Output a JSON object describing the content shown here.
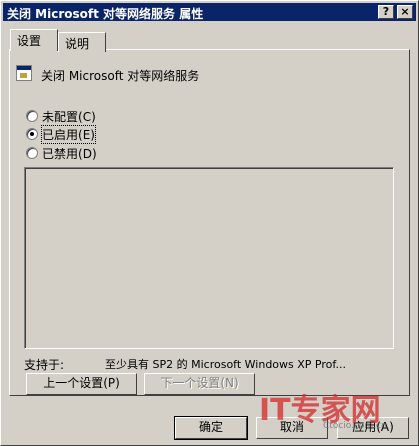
{
  "window": {
    "title": "关闭 Microsoft 对等网络服务 属性",
    "help_button": "?",
    "close_button": "×"
  },
  "tabs": [
    {
      "label": "设置",
      "active": true
    },
    {
      "label": "说明",
      "active": false
    }
  ],
  "policy": {
    "name": "关闭 Microsoft 对等网络服务",
    "icon": "policy-icon"
  },
  "options": [
    {
      "label": "未配置",
      "hotkey": "(C)",
      "selected": false
    },
    {
      "label": "已启用",
      "hotkey": "(E)",
      "selected": true
    },
    {
      "label": "已禁用",
      "hotkey": "(D)",
      "selected": false
    }
  ],
  "supported": {
    "label": "支持于:",
    "value": "至少具有 SP2 的 Microsoft Windows XP Prof..."
  },
  "nav_buttons": {
    "previous": "上一个设置(P)",
    "next": "下一个设置(N)"
  },
  "dialog_buttons": {
    "ok": "确定",
    "cancel": "取消",
    "apply": "应用(A)"
  },
  "watermark": {
    "brand": "IT专家网",
    "site": "Ctocio.com.cn"
  },
  "colors": {
    "titlebar": "#0a246a",
    "face": "#d4d0c8",
    "watermark_red": "#d42a2a"
  }
}
